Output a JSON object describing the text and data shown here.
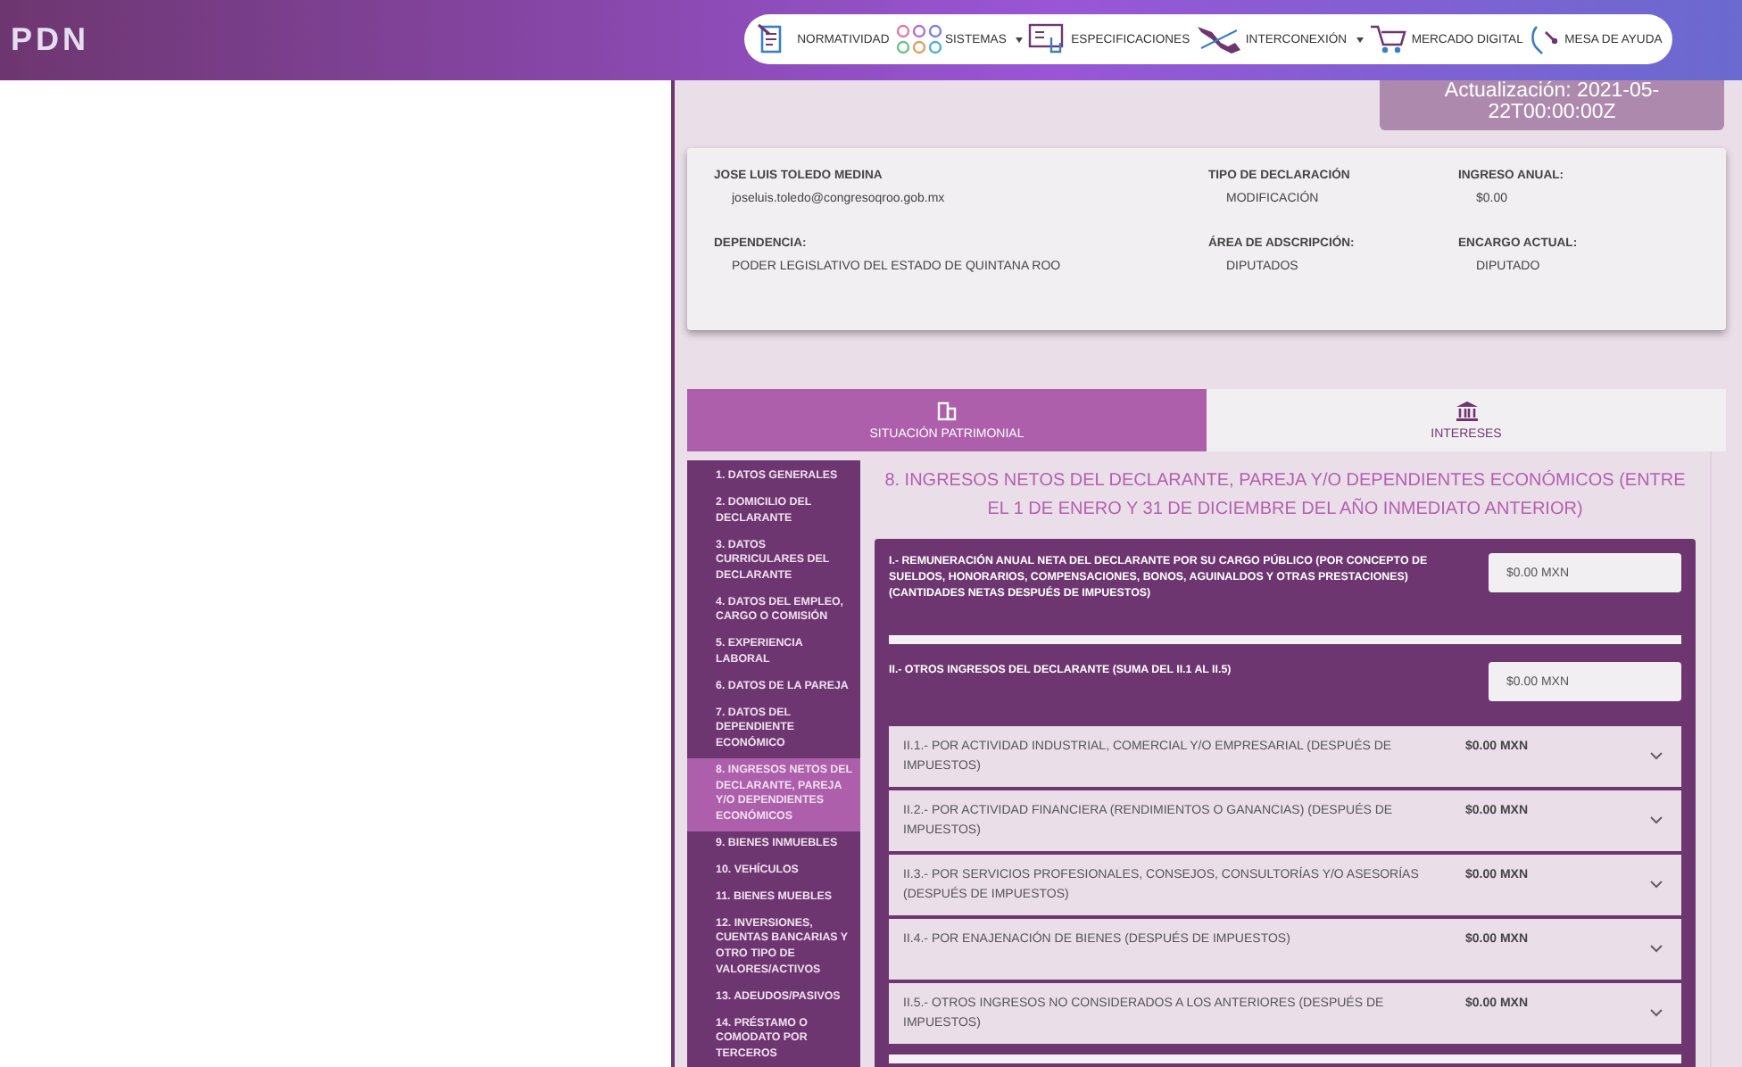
{
  "header": {
    "logo": "PDN",
    "nav": [
      {
        "label": "NORMATIVIDAD",
        "dropdown": false
      },
      {
        "label": "SISTEMAS",
        "dropdown": true
      },
      {
        "label": "ESPECIFICACIONES",
        "dropdown": false
      },
      {
        "label": "INTERCONEXIÓN",
        "dropdown": true
      },
      {
        "label": "MERCADO DIGITAL",
        "dropdown": false
      },
      {
        "label": "MESA DE AYUDA",
        "dropdown": false
      }
    ]
  },
  "update_badge": "Actualización: 2021-05-22T00:00:00Z",
  "summary": {
    "fields": [
      {
        "label": "JOSE LUIS TOLEDO MEDINA",
        "value": "joseluis.toledo@congresoqroo.gob.mx"
      },
      {
        "label": "TIPO DE DECLARACIÓN",
        "value": "MODIFICACIÓN"
      },
      {
        "label": "INGRESO ANUAL:",
        "value": "$0.00"
      },
      {
        "label": "DEPENDENCIA:",
        "value": "PODER LEGISLATIVO DEL ESTADO DE QUINTANA ROO"
      },
      {
        "label": "ÁREA DE ADSCRIPCIÓN:",
        "value": "DIPUTADOS"
      },
      {
        "label": "ENCARGO ACTUAL:",
        "value": "DIPUTADO"
      }
    ]
  },
  "tabs": [
    {
      "label": "SITUACIÓN PATRIMONIAL",
      "selected": true
    },
    {
      "label": "INTERESES",
      "selected": false
    }
  ],
  "sidebar": {
    "items": [
      {
        "label": "1. DATOS GENERALES",
        "selected": false
      },
      {
        "label": "2. DOMICILIO DEL DECLARANTE",
        "selected": false
      },
      {
        "label": "3. DATOS CURRICULARES DEL DECLARANTE",
        "selected": false
      },
      {
        "label": "4. DATOS DEL EMPLEO, CARGO O COMISIÓN",
        "selected": false
      },
      {
        "label": "5. EXPERIENCIA LABORAL",
        "selected": false
      },
      {
        "label": "6. DATOS DE LA PAREJA",
        "selected": false
      },
      {
        "label": "7. DATOS DEL DEPENDIENTE ECONÓMICO",
        "selected": false
      },
      {
        "label": "8. INGRESOS NETOS DEL DECLARANTE, PAREJA Y/O DEPENDIENTES ECONÓMICOS",
        "selected": true
      },
      {
        "label": "9. BIENES INMUEBLES",
        "selected": false
      },
      {
        "label": "10. VEHÍCULOS",
        "selected": false
      },
      {
        "label": "11. BIENES MUEBLES",
        "selected": false
      },
      {
        "label": "12. INVERSIONES, CUENTAS BANCARIAS Y OTRO TIPO DE VALORES/ACTIVOS",
        "selected": false
      },
      {
        "label": "13. ADEUDOS/PASIVOS",
        "selected": false
      },
      {
        "label": "14. PRÉSTAMO O COMODATO POR TERCEROS",
        "selected": false
      }
    ]
  },
  "section": {
    "title": "8. INGRESOS NETOS DEL DECLARANTE, PAREJA Y/O DEPENDIENTES ECONÓMICOS (ENTRE EL 1 DE ENERO Y 31 DE DICIEMBRE DEL AÑO INMEDIATO ANTERIOR)",
    "remuneration": {
      "label": "I.- REMUNERACIÓN ANUAL NETA DEL DECLARANTE POR SU CARGO PÚBLICO (POR CONCEPTO DE SUELDOS, HONORARIOS, COMPENSACIONES, BONOS, AGUINALDOS Y OTRAS PRESTACIONES) (CANTIDADES NETAS DESPUÉS DE IMPUESTOS)",
      "value": "$0.00 MXN"
    },
    "other_income": {
      "label": "II.- OTROS INGRESOS DEL DECLARANTE (SUMA DEL II.1 AL II.5)",
      "value": "$0.00 MXN"
    },
    "breakdown": [
      {
        "label": "II.1.- POR ACTIVIDAD INDUSTRIAL, COMERCIAL Y/O EMPRESARIAL (DESPUÉS DE IMPUESTOS)",
        "amount": "$0.00 MXN",
        "expanded": false
      },
      {
        "label": "II.2.- POR ACTIVIDAD FINANCIERA (RENDIMIENTOS O GANANCIAS) (DESPUÉS DE IMPUESTOS)",
        "amount": "$0.00 MXN",
        "expanded": false
      },
      {
        "label": "II.3.- POR SERVICIOS PROFESIONALES, CONSEJOS, CONSULTORÍAS Y/O ASESORÍAS (DESPUÉS DE IMPUESTOS)",
        "amount": "$0.00 MXN",
        "expanded": false
      },
      {
        "label": "II.4.- POR ENAJENACIÓN DE BIENES (DESPUÉS DE IMPUESTOS)",
        "amount": "$0.00 MXN",
        "expanded": false
      },
      {
        "label": "II.5.- OTROS INGRESOS NO CONSIDERADOS A LOS ANTERIORES (DESPUÉS DE IMPUESTOS)",
        "amount": "$0.00 MXN",
        "expanded": false
      }
    ]
  }
}
